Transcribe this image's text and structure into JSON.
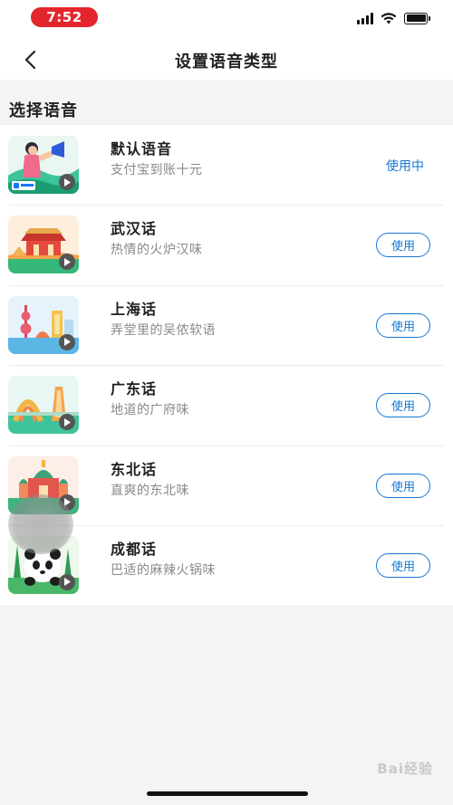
{
  "status_bar": {
    "time": "7:52"
  },
  "header": {
    "title": "设置语音类型"
  },
  "section": {
    "title": "选择语音"
  },
  "voices": [
    {
      "name": "默认语音",
      "desc": "支付宝到账十元",
      "action": "使用中",
      "active": true
    },
    {
      "name": "武汉话",
      "desc": "热情的火炉汉味",
      "action": "使用",
      "active": false
    },
    {
      "name": "上海话",
      "desc": "弄堂里的吴侬软语",
      "action": "使用",
      "active": false
    },
    {
      "name": "广东话",
      "desc": "地道的广府味",
      "action": "使用",
      "active": false
    },
    {
      "name": "东北话",
      "desc": "直爽的东北味",
      "action": "使用",
      "active": false
    },
    {
      "name": "成都话",
      "desc": "巴适的麻辣火锅味",
      "action": "使用",
      "active": false
    }
  ],
  "watermark": "Bai经验",
  "colors": {
    "accent": "#1677d2",
    "time_pill": "#e3262e"
  }
}
